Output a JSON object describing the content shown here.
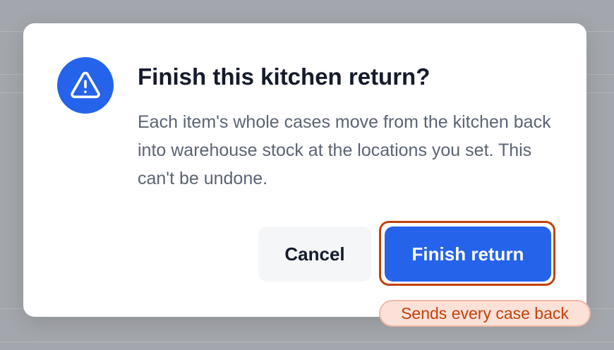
{
  "dialog": {
    "title": "Finish this kitchen return?",
    "body": "Each item's whole cases move from the kitchen back into warehouse stock at the locations you set. This can't be undone.",
    "icon": "warning-triangle-icon",
    "cancel_label": "Cancel",
    "confirm_label": "Finish return"
  },
  "hint": {
    "text": "Sends every case back"
  },
  "colors": {
    "accent": "#2563eb",
    "highlight": "#c2410c",
    "backdrop": "#a3a6ac"
  }
}
